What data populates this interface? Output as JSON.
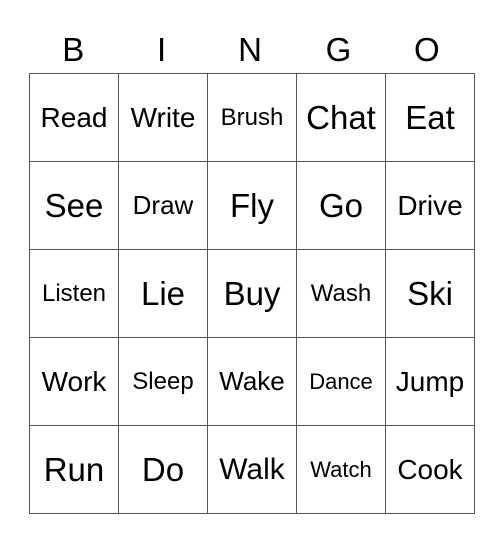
{
  "header": [
    "B",
    "I",
    "N",
    "G",
    "O"
  ],
  "grid": [
    [
      "Read",
      "Write",
      "Brush",
      "Chat",
      "Eat"
    ],
    [
      "See",
      "Draw",
      "Fly",
      "Go",
      "Drive"
    ],
    [
      "Listen",
      "Lie",
      "Buy",
      "Wash",
      "Ski"
    ],
    [
      "Work",
      "Sleep",
      "Wake",
      "Dance",
      "Jump"
    ],
    [
      "Run",
      "Do",
      "Walk",
      "Watch",
      "Cook"
    ]
  ]
}
